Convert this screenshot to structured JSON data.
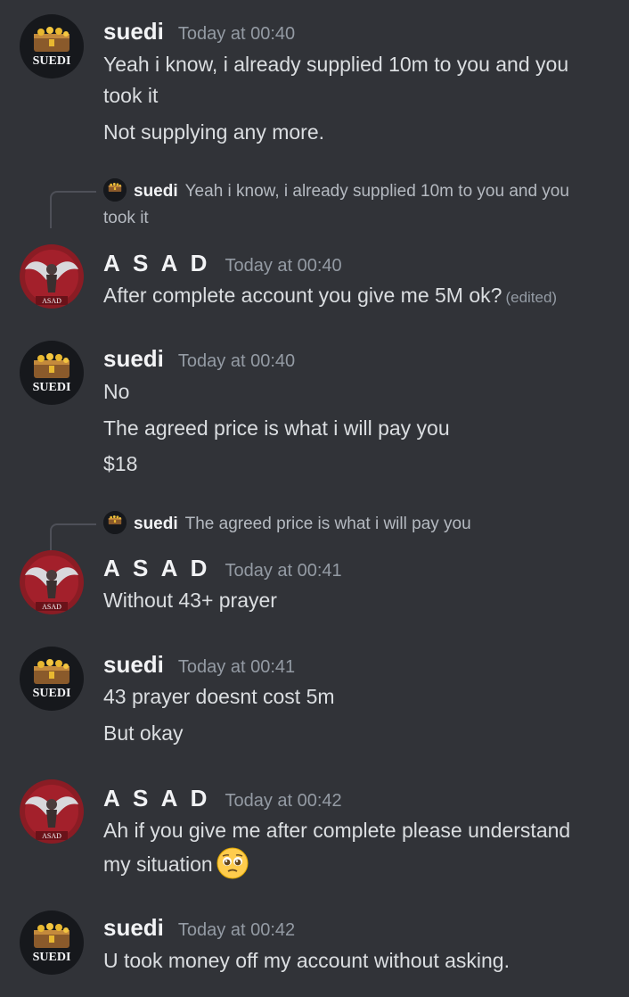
{
  "users": {
    "suedi": {
      "name": "suedi",
      "avatar_icon": "suedi-chest-avatar-icon",
      "avatar_text": "SUEDI",
      "color": "#f2f3f5"
    },
    "asad": {
      "name": "A S A D",
      "avatar_icon": "asad-wings-avatar-icon",
      "avatar_text": "ASAD",
      "color": "#f2f3f5"
    }
  },
  "messages": [
    {
      "author": "suedi",
      "timestamp": "Today at 00:40",
      "lines": [
        "Yeah i know, i already supplied 10m to you and you",
        "took it",
        "Not supplying any more."
      ]
    },
    {
      "author": "A S A D",
      "timestamp": "Today at 00:40",
      "reply": {
        "author": "suedi",
        "text_line1": "Yeah i know, i already supplied 10m to you and you",
        "text_line2": "took it"
      },
      "lines": [
        "After complete account you give me 5M ok?"
      ],
      "edited": "(edited)"
    },
    {
      "author": "suedi",
      "timestamp": "Today at 00:40",
      "lines": [
        "No",
        "The agreed price is what i will pay you",
        "$18"
      ]
    },
    {
      "author": "A S A D",
      "timestamp": "Today at 00:41",
      "reply": {
        "author": "suedi",
        "text_line1": "The agreed price is what i will pay you"
      },
      "lines": [
        "Without 43+ prayer"
      ]
    },
    {
      "author": "suedi",
      "timestamp": "Today at 00:41",
      "lines": [
        "43 prayer doesnt cost 5m",
        "But okay"
      ]
    },
    {
      "author": "A S A D",
      "timestamp": "Today at 00:42",
      "lines": [
        "Ah if you give me after complete please understand",
        "my situation"
      ],
      "emoji": "pleading-face-emoji"
    },
    {
      "author": "suedi",
      "timestamp": "Today at 00:42",
      "lines": [
        "U took money off my account without asking."
      ]
    }
  ]
}
